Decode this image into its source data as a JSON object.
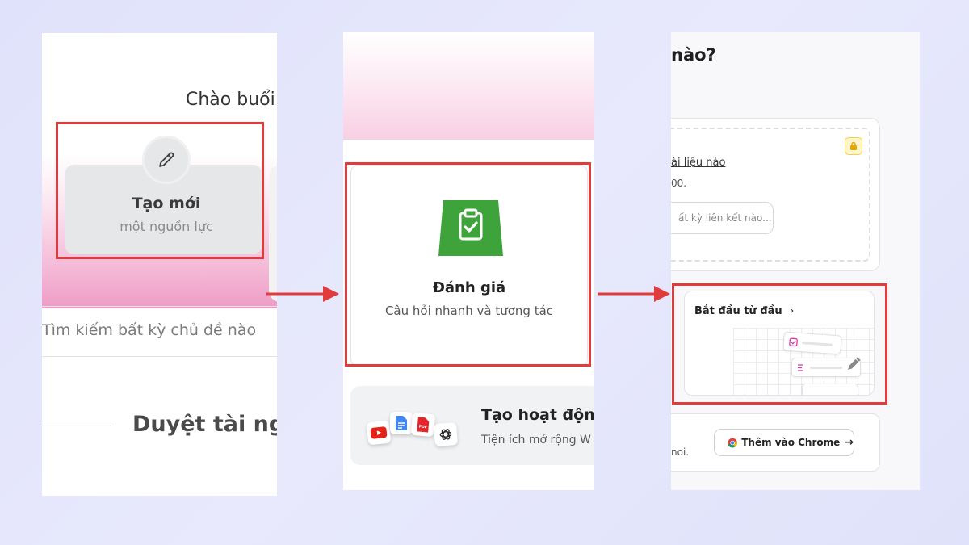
{
  "colors": {
    "highlight": "#e23b3b",
    "arrow": "#e23b3b",
    "assessment_icon": "#3ea33a",
    "lock_badge": "#f2cf53",
    "background": "#e3e5fb"
  },
  "step1": {
    "greeting": "Chào buổi",
    "create_card": {
      "icon": "pencil-icon",
      "title": "Tạo mới",
      "subtitle": "một nguồn lực"
    },
    "search_placeholder": "Tìm kiếm bất kỳ chủ đề nào",
    "browse_heading": "Duyệt tài ngu"
  },
  "step2": {
    "assessment_card": {
      "icon": "clipboard-check-icon",
      "title": "Đánh giá",
      "subtitle": "Câu hỏi nhanh và tương tác"
    },
    "extension_card": {
      "icons": [
        "youtube-icon",
        "google-docs-icon",
        "pdf-icon",
        "openai-icon"
      ],
      "pdf_label": "PDF",
      "title": "Tạo hoạt động",
      "subtitle": "Tiện ích mở rộng W"
    }
  },
  "step3": {
    "heading": "nào?",
    "upload_card": {
      "icon": "lock-icon",
      "link_text": "ài liệu nào",
      "subtext": "00.",
      "link_placeholder": "ất kỳ liên kết nào..."
    },
    "start_card": {
      "label": "Bắt đầu từ đầu",
      "chevron": "›"
    },
    "chrome_card": {
      "small_text": "noi.",
      "button_label": "Thêm vào Chrome",
      "button_arrow": "→"
    }
  }
}
